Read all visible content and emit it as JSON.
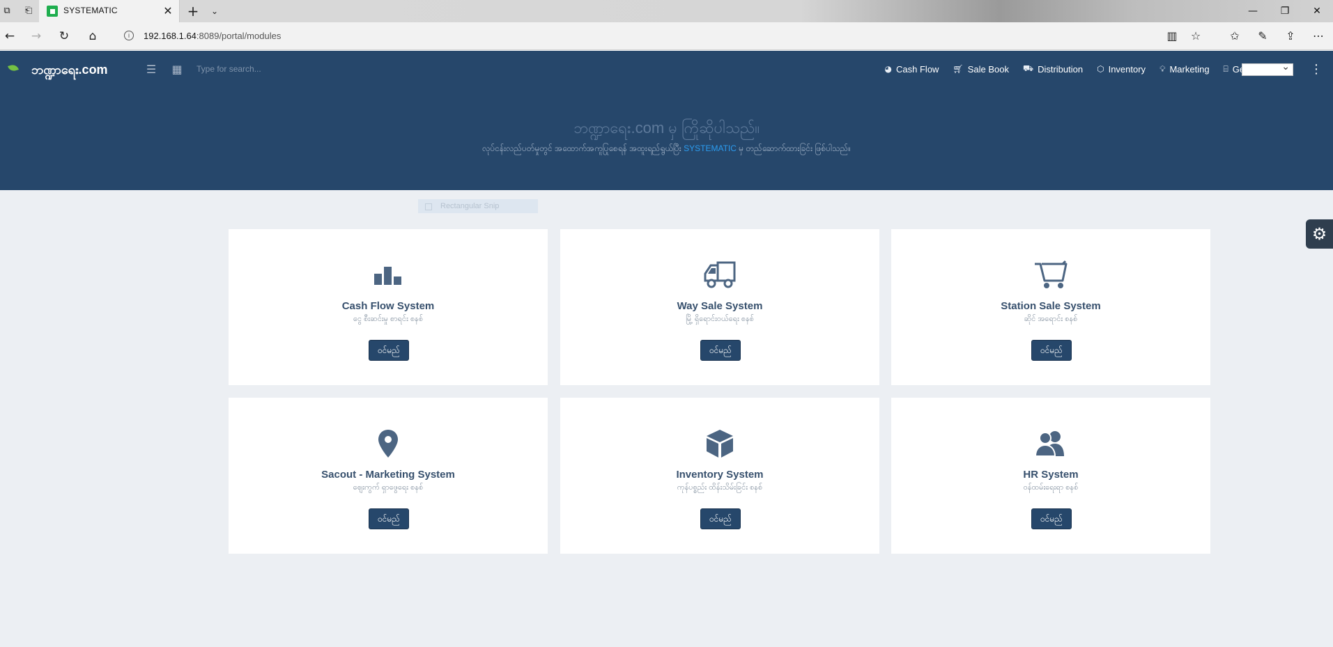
{
  "browser": {
    "tab_title": "SYSTEMATIC",
    "url_host": "192.168.1.64",
    "url_path": ":8089/portal/modules",
    "close_glyph": "✕",
    "newtab_glyph": "+",
    "tabdrop_glyph": "⌄"
  },
  "header": {
    "brand": "ဘဏ္ဍာရေး.com",
    "search_placeholder": "Type for search...",
    "nav": [
      {
        "label": "Cash Flow",
        "icon": "pie-icon"
      },
      {
        "label": "Sale Book",
        "icon": "cart-icon"
      },
      {
        "label": "Distribution",
        "icon": "truck-icon"
      },
      {
        "label": "Inventory",
        "icon": "box-icon"
      },
      {
        "label": "Marketing",
        "icon": "bulb-icon"
      },
      {
        "label": "General",
        "icon": "briefcase-icon"
      }
    ],
    "colors": {
      "header_bg": "#26476b",
      "accent": "#2b9cf0",
      "button_bg": "#26476b"
    }
  },
  "hero": {
    "title": "ဘဏ္ဍာရေး.com မှ ကြိုဆိုပါသည်။",
    "subtitle_before": "လုပ်ငန်းလည်ပတ်မှုတွင် အထောက်အကူပြုစေရန် အထူးရည်ရွယ်ပြီး ",
    "subtitle_accent": "SYSTEMATIC",
    "subtitle_after": " မှ တည်ဆောက်ထားခြင်း ဖြစ်ပါသည်။"
  },
  "snip_label": "Rectangular Snip",
  "modules": [
    {
      "title": "Cash Flow System",
      "subtitle": "ငွေ စီးဆင်းမှု စာရင်း စနစ်",
      "button": "ဝင်မည်",
      "icon": "bar-chart-icon"
    },
    {
      "title": "Way Sale System",
      "subtitle": "မြို့ ရှိရောင်းဝယ်ရေး စနစ်",
      "button": "ဝင်မည်",
      "icon": "truck-icon"
    },
    {
      "title": "Station Sale System",
      "subtitle": "ဆိုင် အရောင်း စနစ်",
      "button": "ဝင်မည်",
      "icon": "cart-icon"
    },
    {
      "title": "Sacout - Marketing System",
      "subtitle": "ဈေးကွက် ရှာဖွေရေး စနစ်",
      "button": "ဝင်မည်",
      "icon": "map-pin-icon"
    },
    {
      "title": "Inventory System",
      "subtitle": "ကုန်ပစ္စည်း ထိန်းသိမ်းခြင်း စနစ်",
      "button": "ဝင်မည်",
      "icon": "cube-icon"
    },
    {
      "title": "HR System",
      "subtitle": "ဝန်ထမ်းရေးရာ စနစ်",
      "button": "ဝင်မည်",
      "icon": "users-icon"
    }
  ]
}
